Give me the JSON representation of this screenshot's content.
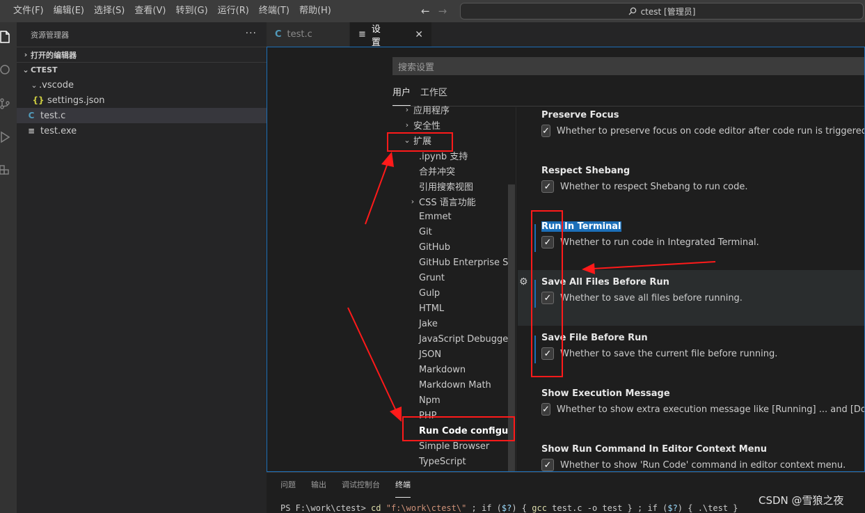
{
  "titlebar": {
    "menu": [
      "文件(F)",
      "编辑(E)",
      "选择(S)",
      "查看(V)",
      "转到(G)",
      "运行(R)",
      "终端(T)",
      "帮助(H)"
    ],
    "back_arrow": "←",
    "forward_arrow": "→",
    "command_center": "ctest [管理员]"
  },
  "activitybar": {
    "icons": [
      "files-icon",
      "search-icon",
      "source-control-icon",
      "run-debug-icon",
      "extensions-icon"
    ]
  },
  "sidebar": {
    "title": "资源管理器",
    "more": "···",
    "open_editors": "打开的编辑器",
    "workspace": "CTEST",
    "tree": [
      {
        "label": ".vscode",
        "icon": "folder-chevron"
      },
      {
        "label": "settings.json",
        "icon": "{}"
      },
      {
        "label": "test.c",
        "icon": "C"
      },
      {
        "label": "test.exe",
        "icon": "≡"
      }
    ]
  },
  "tabs": [
    {
      "label": "test.c",
      "icon": "C"
    },
    {
      "label": "设置",
      "icon": "≡"
    }
  ],
  "settings": {
    "search_placeholder": "搜索设置",
    "scopes": [
      "用户",
      "工作区"
    ],
    "toc": [
      {
        "label": "应用程序",
        "chevron": "›"
      },
      {
        "label": "安全性",
        "chevron": "›"
      },
      {
        "label": "扩展",
        "chevron": "⌄"
      },
      {
        "label": ".ipynb 支持"
      },
      {
        "label": "合并冲突"
      },
      {
        "label": "引用搜索视图"
      },
      {
        "label": "CSS 语言功能",
        "chevron": "›"
      },
      {
        "label": "Emmet"
      },
      {
        "label": "Git"
      },
      {
        "label": "GitHub"
      },
      {
        "label": "GitHub Enterprise Ser..."
      },
      {
        "label": "Grunt"
      },
      {
        "label": "Gulp"
      },
      {
        "label": "HTML"
      },
      {
        "label": "Jake"
      },
      {
        "label": "JavaScript Debugger"
      },
      {
        "label": "JSON"
      },
      {
        "label": "Markdown"
      },
      {
        "label": "Markdown Math"
      },
      {
        "label": "Npm"
      },
      {
        "label": "PHP"
      },
      {
        "label": "Run Code configura..."
      },
      {
        "label": "Simple Browser"
      },
      {
        "label": "TypeScript"
      }
    ],
    "items": [
      {
        "title": "Preserve Focus",
        "desc": "Whether to preserve focus on code editor after code run is triggered.",
        "checked": true
      },
      {
        "title": "Respect Shebang",
        "desc": "Whether to respect Shebang to run code.",
        "checked": true
      },
      {
        "title": "Run In Terminal",
        "desc": "Whether to run code in Integrated Terminal.",
        "checked": true
      },
      {
        "title": "Save All Files Before Run",
        "desc": "Whether to save all files before running.",
        "checked": true
      },
      {
        "title": "Save File Before Run",
        "desc": "Whether to save the current file before running.",
        "checked": true
      },
      {
        "title": "Show Execution Message",
        "desc": "Whether to show extra execution message like [Running] ... and [Done] ...",
        "checked": true
      },
      {
        "title": "Show Run Command In Editor Context Menu",
        "desc": "Whether to show 'Run Code' command in editor context menu.",
        "checked": true
      }
    ],
    "check_glyph": "✓"
  },
  "panel": {
    "tabs": [
      "问题",
      "输出",
      "调试控制台",
      "终端"
    ],
    "terminal": {
      "prompt": "PS F:\\work\\ctest> ",
      "cmd": "cd",
      "path": "\"f:\\work\\ctest\\\"",
      "rest1": " ; if (",
      "var1": "$?",
      "rest2": ") { ",
      "gcc": "gcc",
      "rest3": " test.c -o test } ; if (",
      "var2": "$?",
      "rest4": ") { .\\test }"
    }
  },
  "watermark": "CSDN @雪狼之夜",
  "annotation_color": "#ff1a1a"
}
